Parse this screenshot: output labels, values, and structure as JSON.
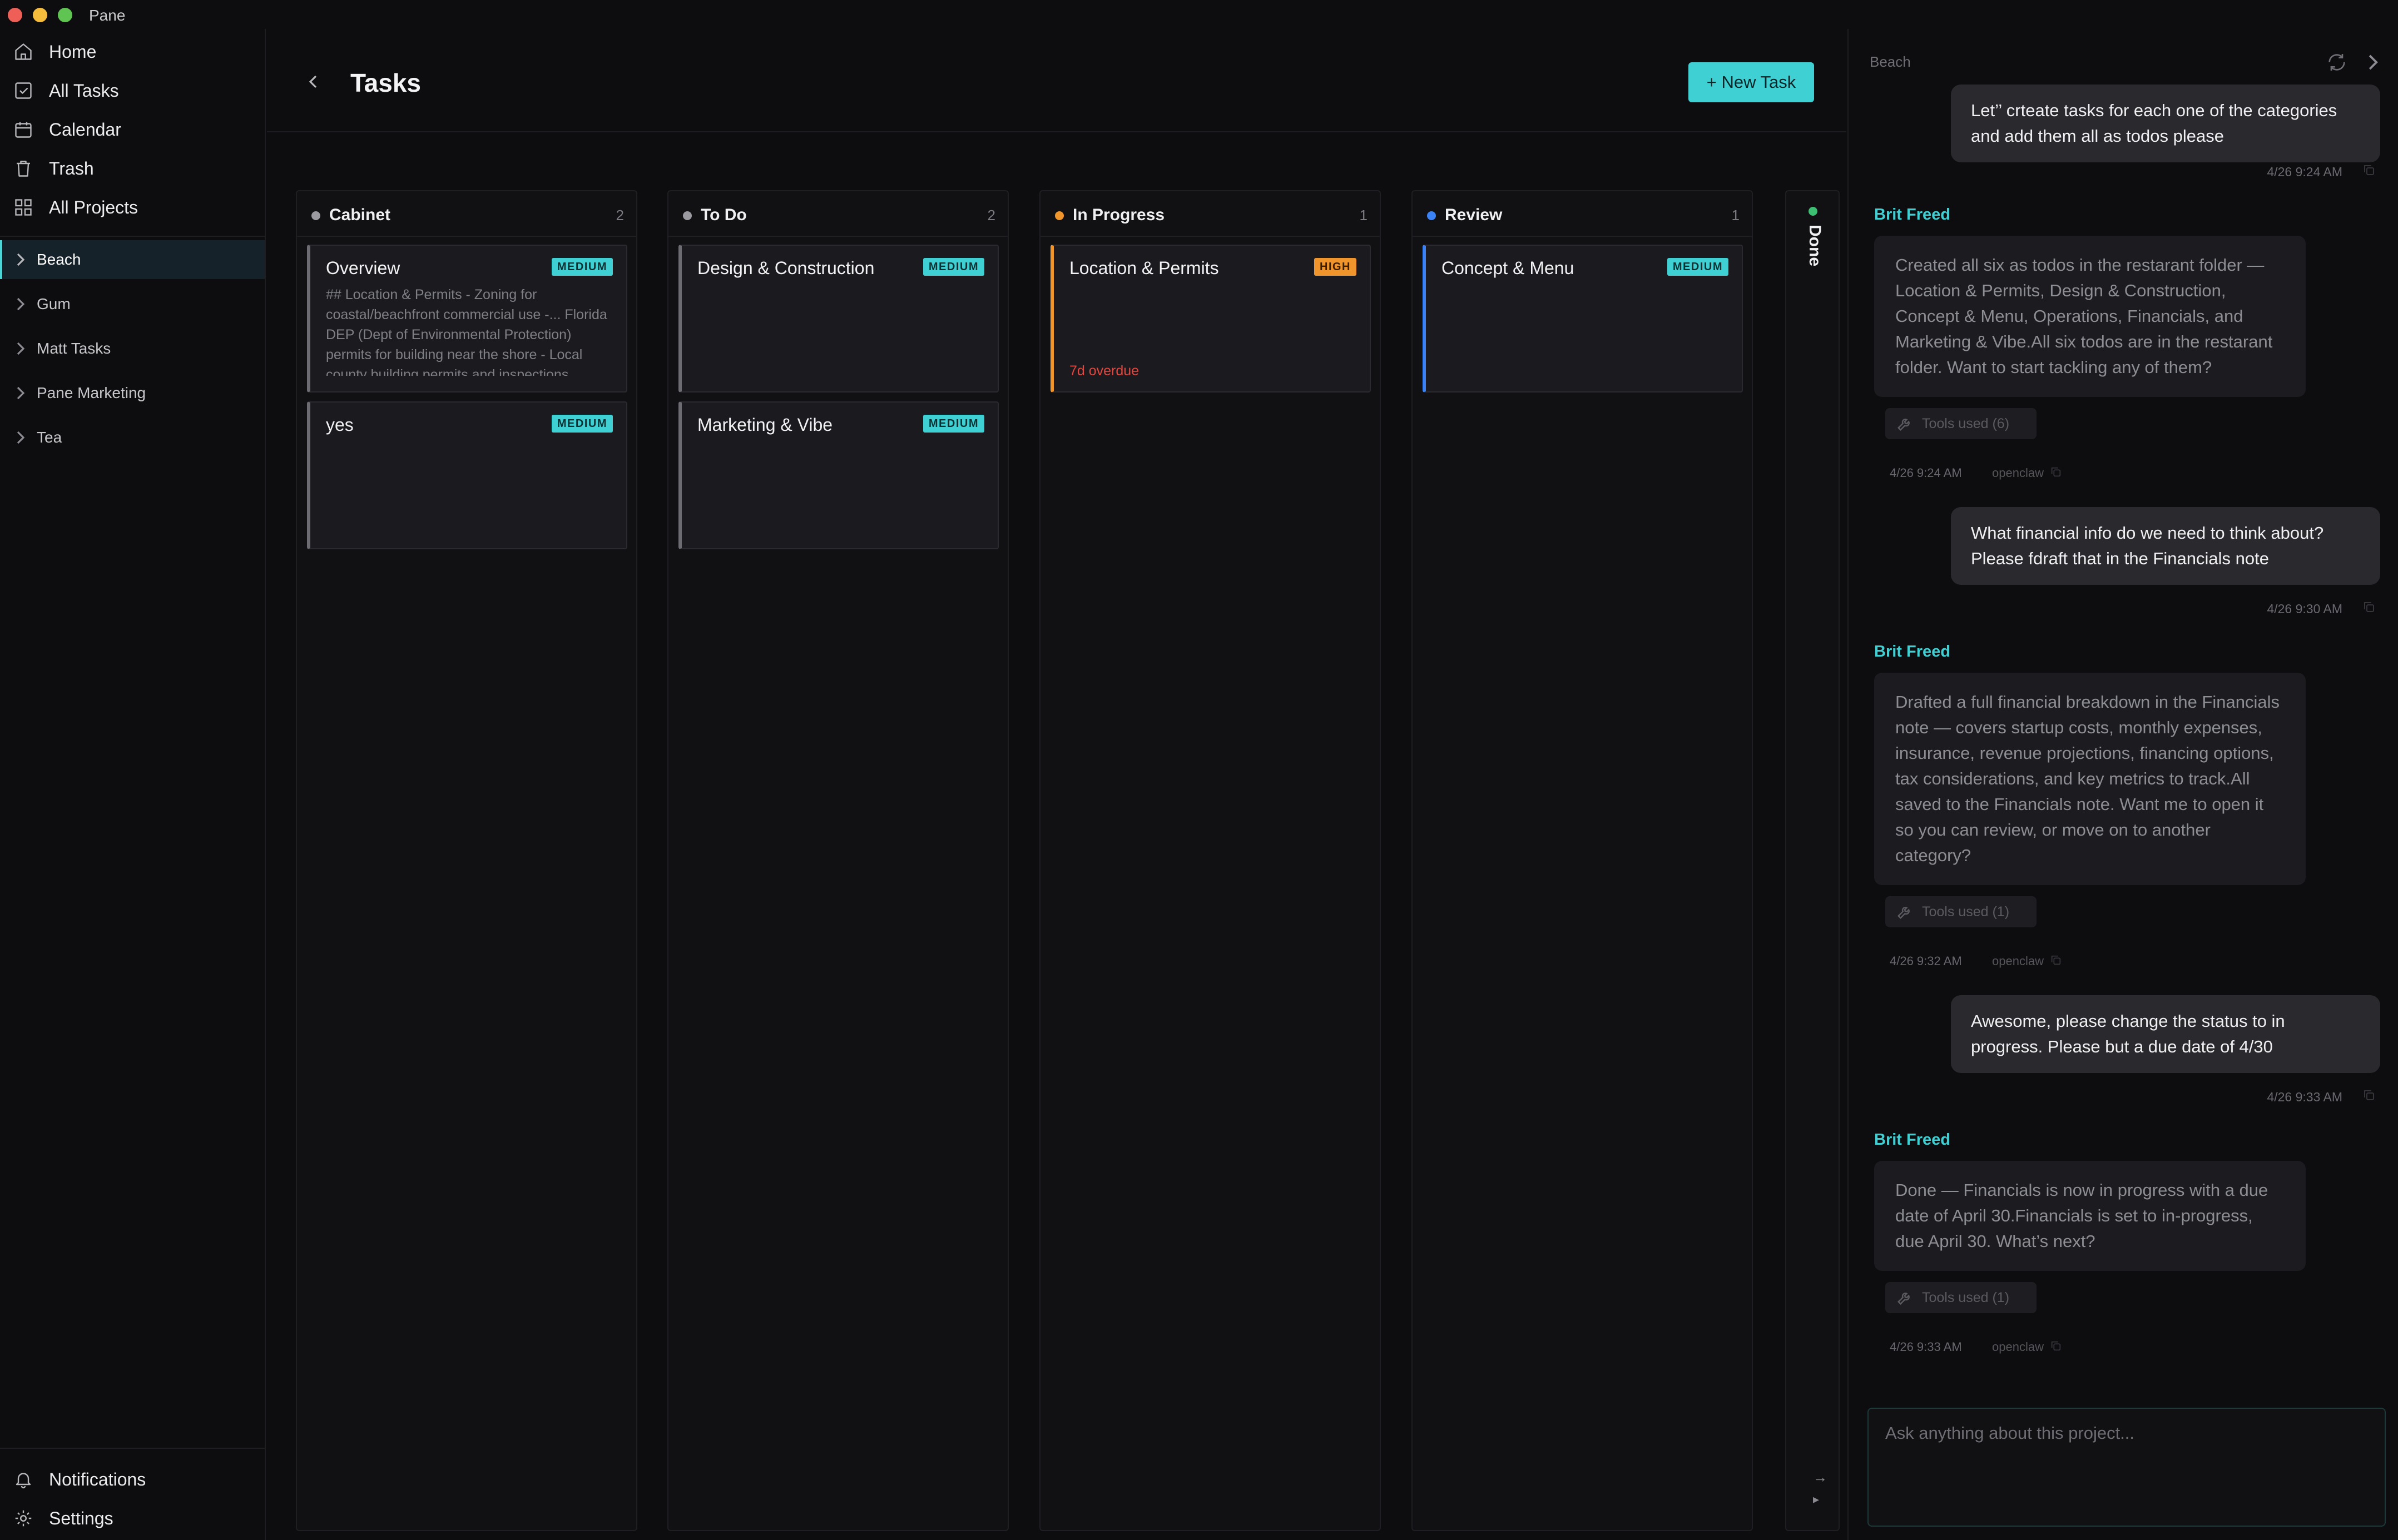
{
  "app": {
    "name": "Pane"
  },
  "sidebar": {
    "nav": [
      {
        "label": "Home",
        "icon": "home-icon"
      },
      {
        "label": "All Tasks",
        "icon": "checkbox-icon"
      },
      {
        "label": "Calendar",
        "icon": "calendar-icon"
      },
      {
        "label": "Trash",
        "icon": "trash-icon"
      },
      {
        "label": "All Projects",
        "icon": "grid-icon"
      }
    ],
    "projects": [
      {
        "label": "Beach",
        "active": true
      },
      {
        "label": "Gum"
      },
      {
        "label": "Matt Tasks"
      },
      {
        "label": "Pane Marketing"
      },
      {
        "label": "Tea"
      }
    ],
    "bottom": [
      {
        "label": "Notifications",
        "icon": "bell-icon"
      },
      {
        "label": "Settings",
        "icon": "gear-icon"
      }
    ]
  },
  "main": {
    "title": "Tasks",
    "new_task_label": "+ New Task",
    "columns": [
      {
        "title": "Cabinet",
        "count": "2",
        "dot_color": "#9a9aa0",
        "cards": [
          {
            "title": "Overview",
            "priority": "MEDIUM",
            "description": "## Location & Permits - Zoning for coastal/beachfront commercial use -... Florida DEP (Dept of Environmental Protection) permits for building near the shore - Local county building permits and inspections",
            "accent": "#6c6c72"
          },
          {
            "title": "yes",
            "priority": "MEDIUM",
            "accent": "#6c6c72"
          }
        ]
      },
      {
        "title": "To Do",
        "count": "2",
        "dot_color": "#9a9aa0",
        "cards": [
          {
            "title": "Design & Construction",
            "priority": "MEDIUM",
            "accent": "#6c6c72"
          },
          {
            "title": "Marketing & Vibe",
            "priority": "MEDIUM",
            "accent": "#6c6c72"
          }
        ]
      },
      {
        "title": "In Progress",
        "count": "1",
        "dot_color": "#f0952c",
        "cards": [
          {
            "title": "Location & Permits",
            "priority": "HIGH",
            "overdue": "7d overdue",
            "accent": "#f0952c"
          }
        ]
      },
      {
        "title": "Review",
        "count": "1",
        "dot_color": "#3b82f6",
        "cards": [
          {
            "title": "Concept & Menu",
            "priority": "MEDIUM",
            "accent": "#3b82f6"
          }
        ]
      }
    ],
    "done_column": {
      "title": "Done",
      "dot_color": "#3dbf73",
      "expand_arrow": "→",
      "expand_caret": "▸"
    }
  },
  "chat": {
    "project": "Beach",
    "messages": [
      {
        "role": "user",
        "text": "Let’’ crteate tasks for each one of the categories and add them all as todos please",
        "time": "4/26 9:24 AM"
      },
      {
        "role": "bot",
        "sender": "Brit Freed",
        "text": "Created all six as todos in the restarant folder — Location & Permits, Design & Construction, Concept & Menu, Operations, Financials, and Marketing & Vibe.All six todos are in the restarant folder. Want to start tackling any of them?",
        "tools": "Tools used (6)",
        "time": "4/26 9:24 AM",
        "source": "openclaw"
      },
      {
        "role": "user",
        "text": "What financial info do we need to think about? Please fdraft that in the Financials note",
        "time": "4/26 9:30 AM"
      },
      {
        "role": "bot",
        "sender": "Brit Freed",
        "text": "Drafted a full financial breakdown in the Financials note — covers startup costs, monthly expenses, insurance, revenue projections, financing options, tax considerations, and key metrics to track.All saved to the Financials note. Want me to open it so you can review, or move on to another category?",
        "tools": "Tools used (1)",
        "time": "4/26 9:32 AM",
        "source": "openclaw"
      },
      {
        "role": "user",
        "text": "Awesome, please change the status to in progress. Please but a due date of 4/30",
        "time": "4/26 9:33 AM"
      },
      {
        "role": "bot",
        "sender": "Brit Freed",
        "text": "Done — Financials is now in progress with a due date of April 30.Financials is set to in-progress, due April 30. What’s next?",
        "tools": "Tools used (1)",
        "time": "4/26 9:33 AM",
        "source": "openclaw"
      }
    ],
    "input_placeholder": "Ask anything about this project..."
  },
  "colors": {
    "accent": "#3fd0d4",
    "high": "#f0952c",
    "overdue": "#e2473f",
    "review": "#3b82f6",
    "done": "#3dbf73"
  }
}
